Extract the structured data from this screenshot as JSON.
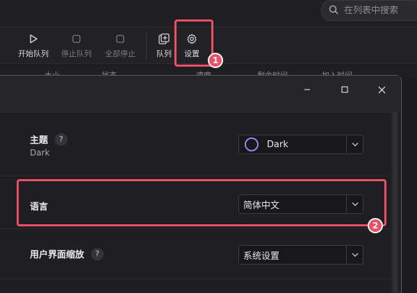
{
  "search": {
    "placeholder": "在列表中搜索"
  },
  "toolbar": {
    "start_queue": "开始队列",
    "stop_queue": "停止队列",
    "stop_all": "全部停止",
    "queue": "队列",
    "settings": "设置"
  },
  "columns": [
    "大小",
    "状态",
    "速度",
    "剩余时间",
    "加入时间"
  ],
  "annotations": {
    "badge1": "1",
    "badge2": "2",
    "accent": "#ee4f62"
  },
  "dialog": {
    "theme": {
      "label": "主题",
      "help": "?",
      "current": "Dark",
      "value": "Dark"
    },
    "language": {
      "label": "语言",
      "value": "简体中文"
    },
    "ui_scale": {
      "label": "用户界面缩放",
      "help": "?",
      "value": "系统设置"
    }
  },
  "colors": {
    "theme_ring": "#9b85e6"
  }
}
